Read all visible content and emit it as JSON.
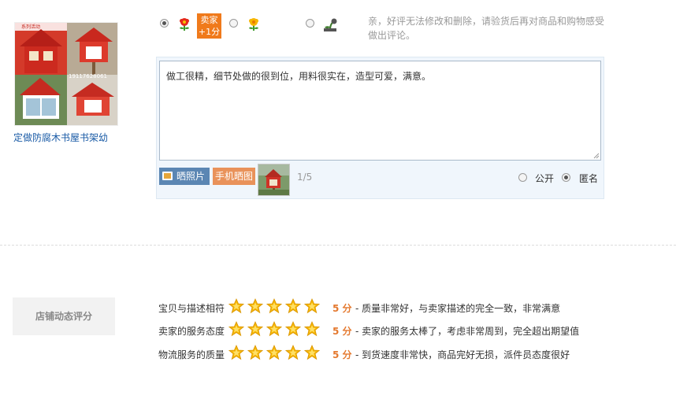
{
  "product": {
    "title": "定做防腐木书屋书架幼",
    "thumb_overlay_text": "19117628061",
    "thumb_top_text": "系列活动"
  },
  "rating_options": [
    {
      "name": "good",
      "selected": true,
      "icon": "red-flower-icon"
    },
    {
      "name": "neutral",
      "selected": false,
      "icon": "yellow-flower-icon"
    },
    {
      "name": "bad",
      "selected": false,
      "icon": "wilted-flower-icon"
    }
  ],
  "seller_badge": {
    "line1": "卖家",
    "line2": "+1分"
  },
  "hint": "亲，好评无法修改和删除，请验货后再对商品和购物感受做出评论。",
  "review": {
    "text": "做工很精，细节处做的很到位，用料很实在，造型可爱，满意。"
  },
  "upload": {
    "photo_button": "晒照片",
    "mobile_button": "手机晒图",
    "count": "1/5"
  },
  "visibility": {
    "public_label": "公开",
    "anonymous_label": "匿名",
    "selected": "anonymous"
  },
  "shop_rating": {
    "title": "店铺动态评分",
    "rows": [
      {
        "label": "宝贝与描述相符",
        "stars": 5,
        "score": "5 分",
        "desc": "- 质量非常好，与卖家描述的完全一致，非常满意"
      },
      {
        "label": "卖家的服务态度",
        "stars": 5,
        "score": "5 分",
        "desc": "- 卖家的服务太棒了，考虑非常周到，完全超出期望值"
      },
      {
        "label": "物流服务的质量",
        "stars": 5,
        "score": "5 分",
        "desc": "- 到货速度非常快，商品完好无损，派件员态度很好"
      }
    ]
  },
  "colors": {
    "accent_orange": "#f07a1b",
    "score_orange": "#e4792f",
    "link_blue": "#1a5ba6",
    "star_gold": "#f5b400"
  }
}
